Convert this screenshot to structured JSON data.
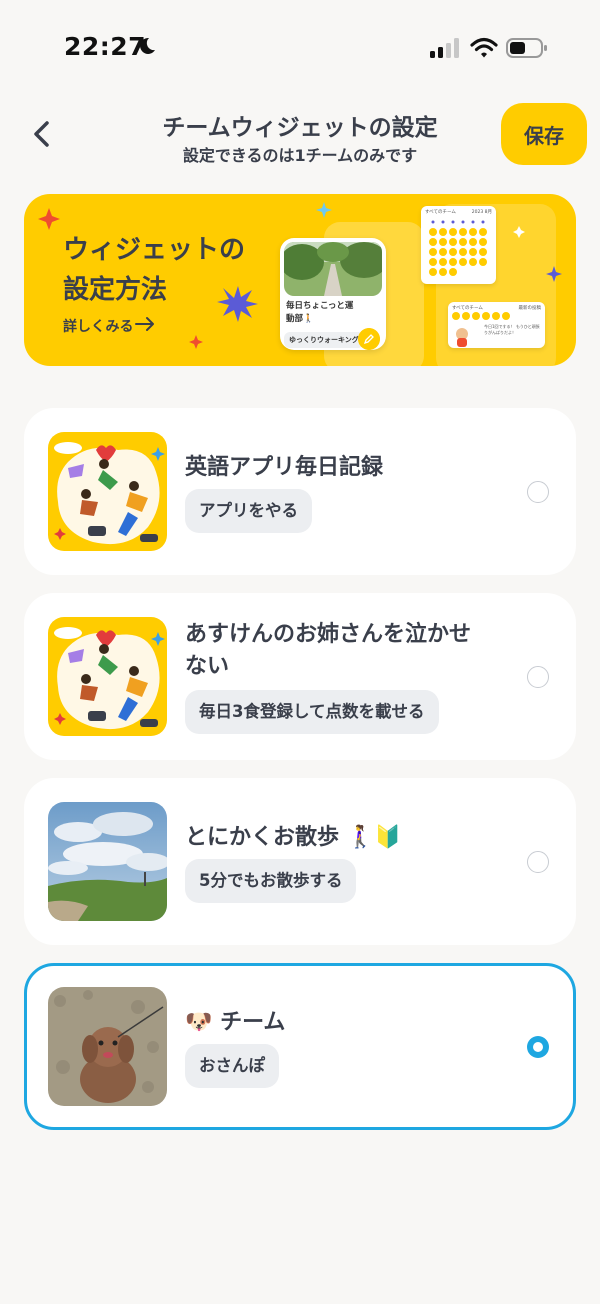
{
  "status_bar": {
    "time": "22:27"
  },
  "header": {
    "title": "チームウィジェットの設定",
    "subtitle": "設定できるのは1チームのみです",
    "save_label": "保存"
  },
  "banner": {
    "title_line1": "ウィジェットの",
    "title_line2": "設定方法",
    "link_label": "詳しくみる",
    "preview_card": {
      "name": "毎日ちょこっと運動部🚶",
      "tag": "ゆっくりウォーキング"
    },
    "preview_calendar": {
      "title": "すべてのチーム",
      "date": "2023 8月"
    },
    "preview_feed": {
      "title": "すべてのチーム",
      "extra": "最新の投稿",
      "text": "今日1回でする！ もうひと頑張りがんばりだよ！"
    }
  },
  "teams": [
    {
      "name": "英語アプリ毎日記録",
      "tag": "アプリをやる",
      "selected": false,
      "thumb": "illustration"
    },
    {
      "name": "あすけんのお姉さんを泣かせない",
      "tag": "毎日3食登録して点数を載せる",
      "selected": false,
      "thumb": "illustration"
    },
    {
      "name": "とにかくお散歩",
      "name_emoji": "🚶‍♀️🔰",
      "tag": "5分でもお散歩する",
      "selected": false,
      "thumb": "sky-photo"
    },
    {
      "name": "チーム",
      "name_emoji": "🐶",
      "tag": "おさんぽ",
      "selected": true,
      "thumb": "dog-photo"
    }
  ],
  "colors": {
    "accent": "#ffcc00",
    "selected_border": "#1ea7e1",
    "text": "#3a3f4b",
    "tag_bg": "#eceef1"
  }
}
